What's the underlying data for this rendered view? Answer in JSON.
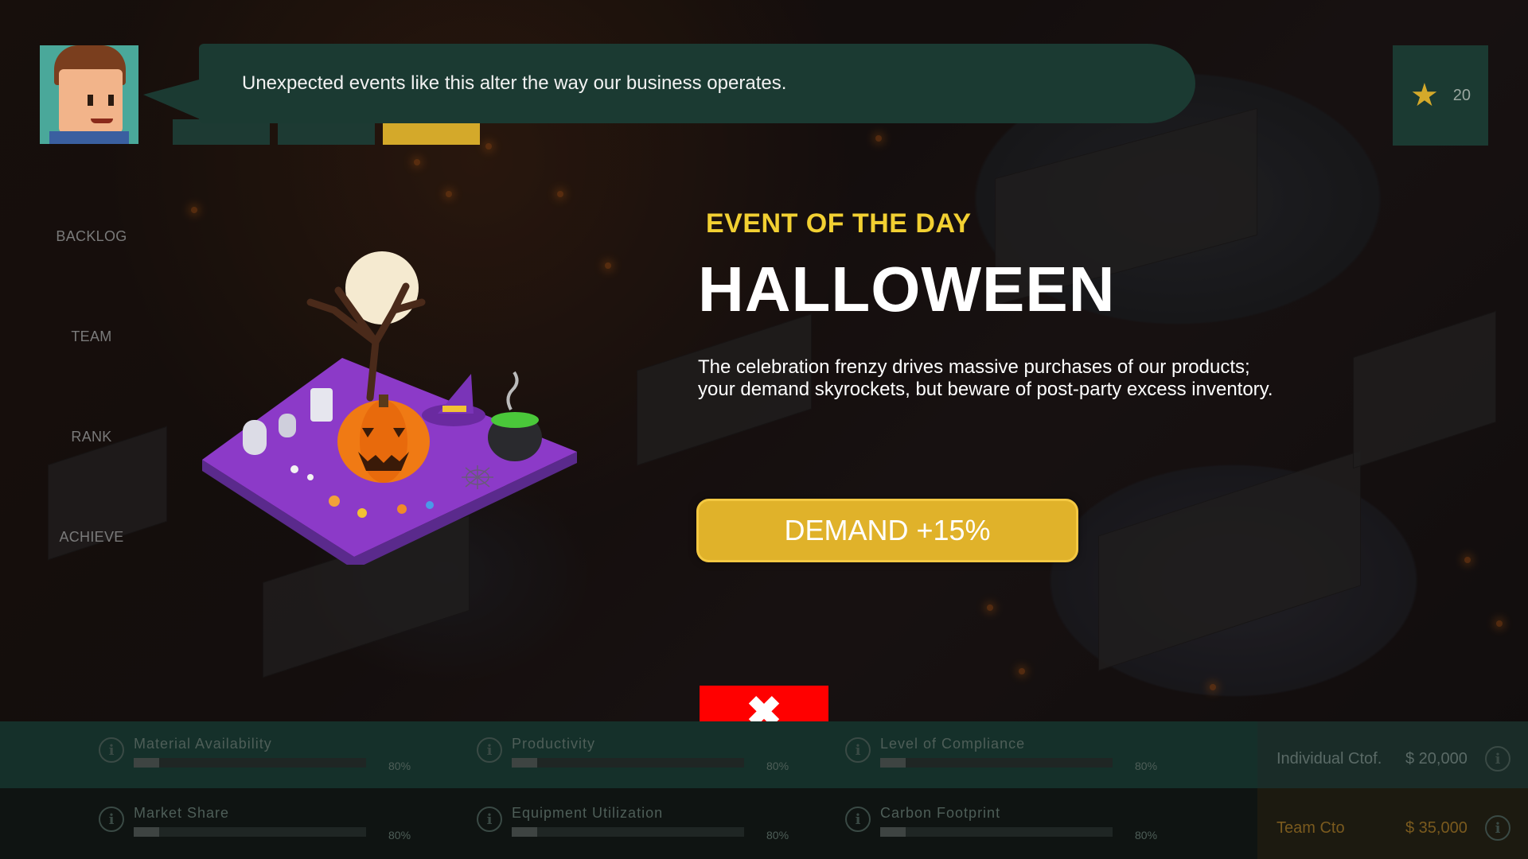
{
  "coach": {
    "message": "Unexpected events like this alter the way our business operates."
  },
  "score": {
    "icon": "star-icon",
    "value": "20"
  },
  "sidebar": {
    "items": [
      {
        "label": "BACKLOG"
      },
      {
        "label": "TEAM"
      },
      {
        "label": "RANK"
      },
      {
        "label": "ACHIEVE"
      }
    ]
  },
  "event": {
    "kicker": "EVENT OF THE DAY",
    "title": "HALLOWEEN",
    "description_line1": "The celebration frenzy drives massive purchases of our products;",
    "description_line2": "your demand skyrockets, but beware of post-party excess inventory.",
    "effect": "DEMAND +15%",
    "close_icon": "close-icon"
  },
  "kpis": {
    "row1": [
      {
        "label": "Material Availability",
        "percent": "80%",
        "fill": 0.11
      },
      {
        "label": "Productivity",
        "percent": "80%",
        "fill": 0.11
      },
      {
        "label": "Level of Compliance",
        "percent": "80%",
        "fill": 0.11
      }
    ],
    "row2": [
      {
        "label": "Market Share",
        "percent": "80%",
        "fill": 0.11
      },
      {
        "label": "Equipment Utilization",
        "percent": "80%",
        "fill": 0.11
      },
      {
        "label": "Carbon Footprint",
        "percent": "80%",
        "fill": 0.11
      }
    ]
  },
  "costs": {
    "individual": {
      "label": "Individual Ctof.",
      "amount": "$ 20,000"
    },
    "team": {
      "label": "Team Cto",
      "amount": "$ 35,000"
    }
  },
  "colors": {
    "accent_yellow": "#f2d032",
    "panel_green": "#1b3a32",
    "close_red": "#ff0000",
    "team_cost_text": "#7a5a1e",
    "individual_cost_text": "#5a6a66"
  }
}
